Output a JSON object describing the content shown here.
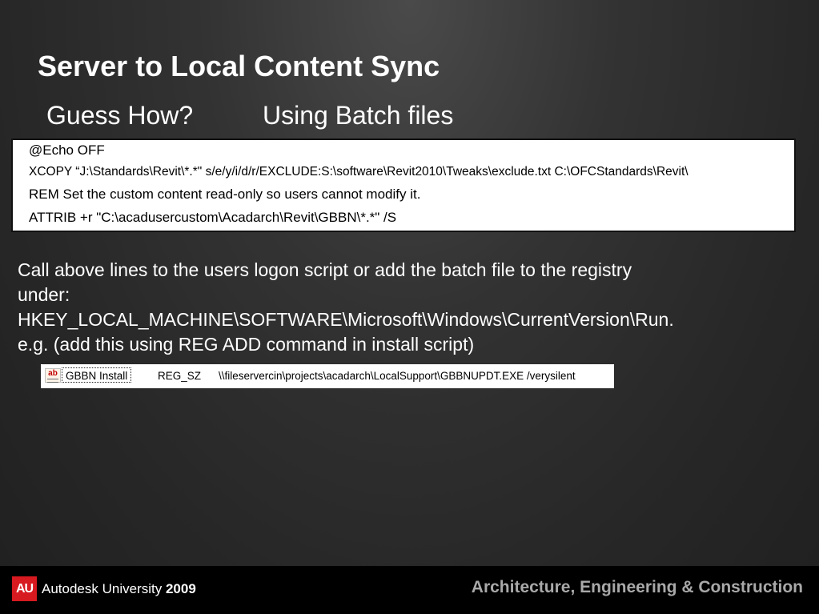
{
  "slide": {
    "title": "Server to Local Content Sync",
    "subtitle_left": "Guess How?",
    "subtitle_right": "Using Batch files"
  },
  "code_box": {
    "lines": [
      "@Echo OFF",
      "XCOPY “J:\\Standards\\Revit\\*.*\" s/e/y/i/d/r/EXCLUDE:S:\\software\\Revit2010\\Tweaks\\exclude.txt C:\\OFCStandards\\Revit\\",
      "REM Set the custom content read-only so users cannot modify it.",
      "ATTRIB +r \"C:\\acadusercustom\\Acadarch\\Revit\\GBBN\\*.*\" /S"
    ]
  },
  "body": {
    "lines": [
      "Call above lines to the users logon script or add the batch file to the registry",
      "under:",
      "HKEY_LOCAL_MACHINE\\SOFTWARE\\Microsoft\\Windows\\CurrentVersion\\Run.",
      "e.g.  (add this using REG ADD command in install script)"
    ]
  },
  "registry_entry": {
    "icon_text": "ab",
    "name": "GBBN Install",
    "type": "REG_SZ",
    "data": "\\\\fileservercin\\projects\\acadarch\\LocalSupport\\GBBNUPDT.EXE /verysilent"
  },
  "footer": {
    "logo_text": "AU",
    "brand": "Autodesk University",
    "year": "2009",
    "track": "Architecture, Engineering & Construction"
  },
  "colors": {
    "logo_red": "#d71920",
    "track_gray": "#a9a9a9"
  }
}
